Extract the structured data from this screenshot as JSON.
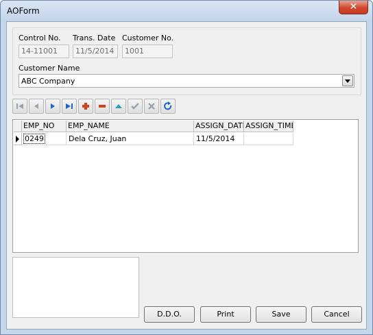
{
  "window": {
    "title": "AOForm",
    "close_glyph": "✕"
  },
  "header": {
    "control_no": {
      "label": "Control No.",
      "value": "14-11001"
    },
    "trans_date": {
      "label": "Trans. Date",
      "value": "11/5/2014"
    },
    "customer_no": {
      "label": "Customer No.",
      "value": "1001"
    },
    "customer_name": {
      "label": "Customer Name",
      "value": "ABC Company"
    }
  },
  "navigator": {
    "buttons": [
      "first-icon",
      "prior-icon",
      "next-icon",
      "last-icon",
      "insert-icon",
      "delete-icon",
      "edit-icon",
      "post-icon",
      "cancel-icon",
      "refresh-icon"
    ]
  },
  "grid": {
    "columns": [
      "EMP_NO",
      "EMP_NAME",
      "ASSIGN_DATE",
      "ASSIGN_TIME"
    ],
    "rows": [
      {
        "emp_no": "0249",
        "emp_name": "Dela Cruz, Juan",
        "assign_date": "11/5/2014",
        "assign_time": ""
      }
    ]
  },
  "memo": {
    "value": ""
  },
  "buttons": {
    "ddo": "D.D.O.",
    "print": "Print",
    "save": "Save",
    "cancel": "Cancel"
  },
  "colors": {
    "title_bar": "#c6d6ea",
    "close_button": "#d2482e",
    "nav_blue": "#1e63c8",
    "nav_red": "#d0431d",
    "nav_teal": "#2a9fb5"
  }
}
